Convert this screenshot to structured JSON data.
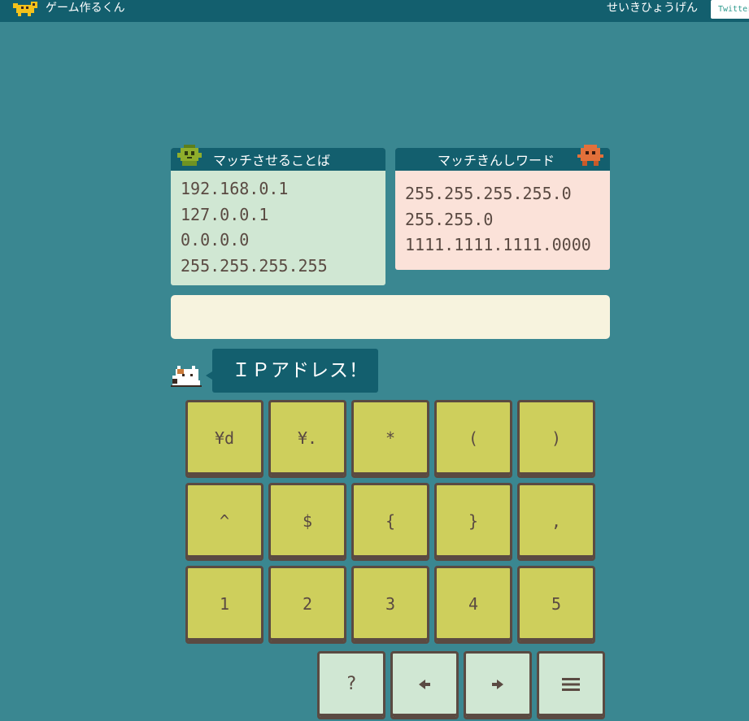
{
  "app": {
    "title": "ゲーム作るくん",
    "regex_link": "せいきひょうげん",
    "twitter_button": "Twitter"
  },
  "match_panel": {
    "title": "マッチさせることば",
    "items": [
      "192.168.0.1",
      "127.0.0.1",
      "0.0.0.0",
      "255.255.255.255"
    ]
  },
  "nomatch_panel": {
    "title": "マッチきんしワード",
    "items": [
      "255.255.255.255.0",
      "255.255.0",
      "1111.1111.1111.0000"
    ]
  },
  "answer": {
    "value": ""
  },
  "hint": {
    "text": "ＩＰアドレス！"
  },
  "keypad": {
    "row1": [
      "¥d",
      "¥.",
      "*",
      "(",
      ")"
    ],
    "row2": [
      "^",
      "$",
      "{",
      "}",
      ","
    ],
    "row3": [
      "1",
      "2",
      "3",
      "4",
      "5"
    ]
  },
  "tools": {
    "help": "?",
    "left": "◆",
    "right": "◆",
    "menu": "≡"
  },
  "colors": {
    "background": "#3a8791",
    "header": "#135f6e",
    "key": "#cecf5c",
    "match_panel": "#d0e7d3",
    "nomatch_panel": "#fbe2d9",
    "answer_field": "#f7f3de"
  },
  "icons": {
    "logo": "pixel-dog-logo",
    "match_mascot": "green-pixel-creature",
    "nomatch_mascot": "orange-pixel-creature",
    "hint_character": "pixel-cat"
  }
}
